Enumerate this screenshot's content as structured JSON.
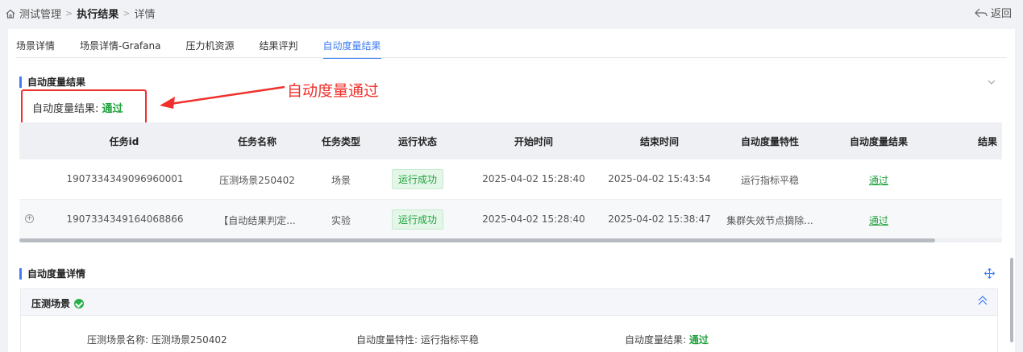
{
  "breadcrumb": {
    "home": "测试管理",
    "current": "执行结果",
    "leaf": "详情"
  },
  "back_label": "返回",
  "tabs": [
    "场景详情",
    "场景详情-Grafana",
    "压力机资源",
    "结果评判",
    "自动度量结果"
  ],
  "active_tab": 4,
  "section1": {
    "title": "自动度量结果",
    "result_label": "自动度量结果:",
    "result_value": "通过"
  },
  "annotation": "自动度量通过",
  "table": {
    "headers": [
      "任务id",
      "任务名称",
      "任务类型",
      "运行状态",
      "开始时间",
      "结束时间",
      "自动度量特性",
      "自动度量结果",
      "结果"
    ],
    "rows": [
      {
        "id": "1907334349096960001",
        "name": "压测场景250402",
        "type": "场景",
        "status": "运行成功",
        "start": "2025-04-02 15:28:40",
        "end": "2025-04-02 15:43:54",
        "feature": "运行指标平稳",
        "result": "通过"
      },
      {
        "id": "1907334349164068866",
        "name": "【自动结果判定...",
        "type": "实验",
        "status": "运行成功",
        "start": "2025-04-02 15:28:40",
        "end": "2025-04-02 15:38:47",
        "feature": "集群失效节点摘除...",
        "result": "通过"
      }
    ]
  },
  "section2": {
    "title": "自动度量详情",
    "scene_name_header": "压测场景",
    "scene_name_label": "压测场景名称:",
    "scene_name_value": "压测场景250402",
    "feature_label": "自动度量特性:",
    "feature_value": "运行指标平稳",
    "result_label": "自动度量结果:",
    "result_value": "通过"
  },
  "colors": {
    "accent": "#3f7cf6",
    "pass": "#1fa33c",
    "annotation": "#f0302c"
  }
}
